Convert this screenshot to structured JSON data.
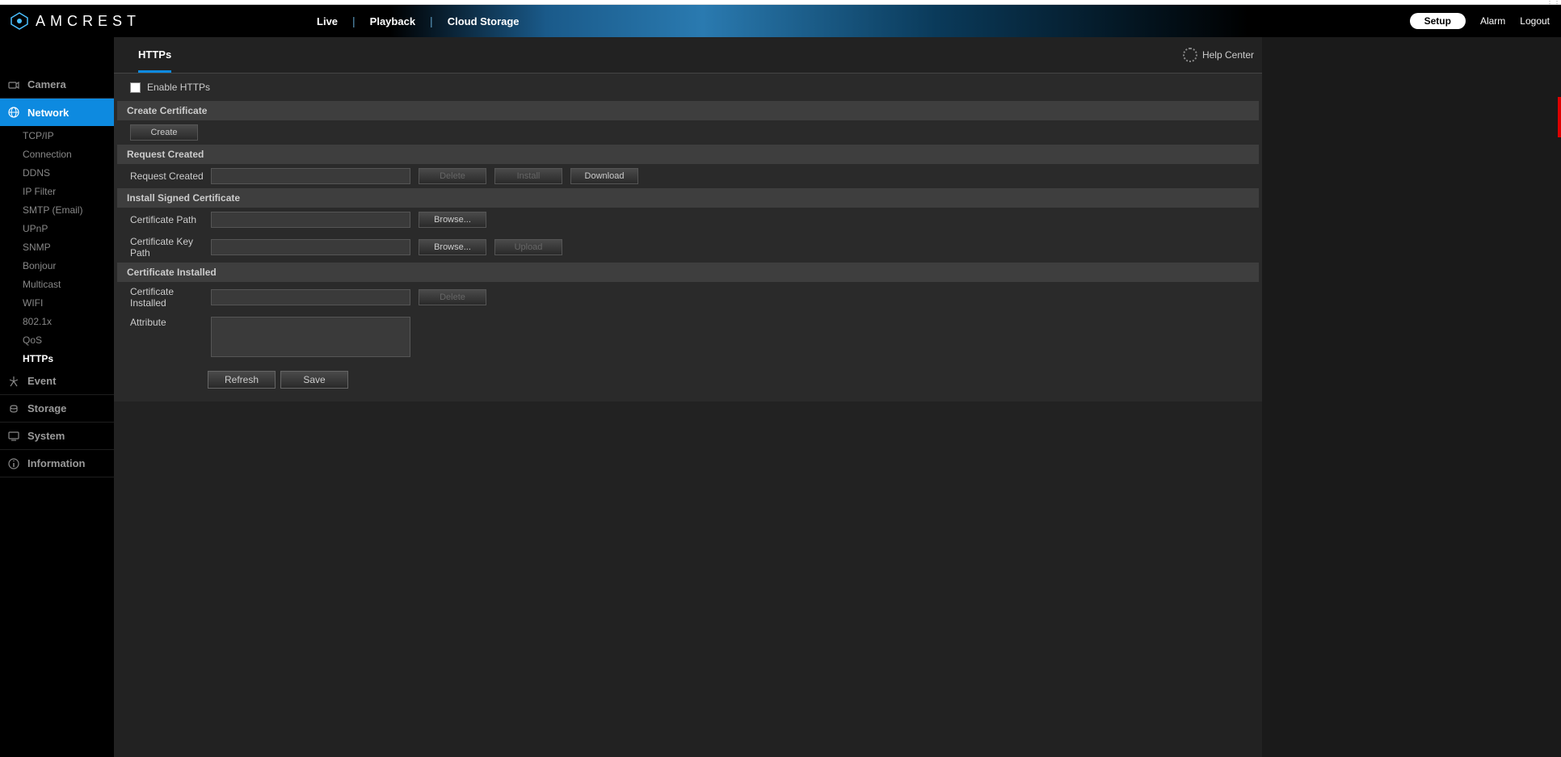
{
  "brand": "AMCREST",
  "nav": {
    "live": "Live",
    "playback": "Playback",
    "cloud": "Cloud Storage"
  },
  "navRight": {
    "setup": "Setup",
    "alarm": "Alarm",
    "logout": "Logout"
  },
  "sidebar": {
    "camera": "Camera",
    "network": "Network",
    "sub": {
      "tcpip": "TCP/IP",
      "connection": "Connection",
      "ddns": "DDNS",
      "ipfilter": "IP Filter",
      "smtp": "SMTP (Email)",
      "upnp": "UPnP",
      "snmp": "SNMP",
      "bonjour": "Bonjour",
      "multicast": "Multicast",
      "wifi": "WIFI",
      "8021x": "802.1x",
      "qos": "QoS",
      "https": "HTTPs"
    },
    "event": "Event",
    "storage": "Storage",
    "system": "System",
    "information": "Information"
  },
  "tab": "HTTPs",
  "helpCenter": "Help Center",
  "form": {
    "enableLabel": "Enable HTTPs",
    "createCert": "Create Certificate",
    "createBtn": "Create",
    "requestCreated": "Request Created",
    "requestCreatedLabel": "Request Created",
    "requestCreatedValue": "",
    "delete": "Delete",
    "install": "Install",
    "download": "Download",
    "installSigned": "Install Signed Certificate",
    "certPath": "Certificate Path",
    "certPathValue": "",
    "certKeyPath": "Certificate Key Path",
    "certKeyPathValue": "",
    "browse": "Browse...",
    "upload": "Upload",
    "certInstalled": "Certificate Installed",
    "certInstalledLabel": "Certificate Installed",
    "certInstalledValue": "",
    "attribute": "Attribute",
    "attributeValue": "",
    "refresh": "Refresh",
    "save": "Save"
  }
}
